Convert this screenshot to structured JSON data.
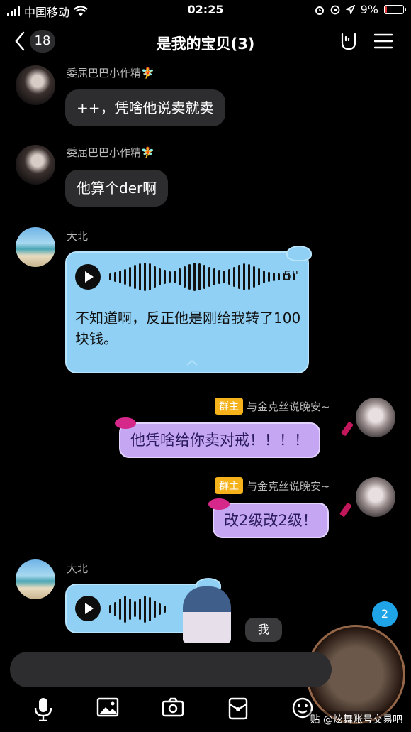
{
  "status_bar": {
    "carrier": "中国移动",
    "time": "02:25",
    "battery": "9%",
    "battery_level": 0.09,
    "icons": [
      "signal-icon",
      "wifi-icon",
      "alarm-icon",
      "lock-rotation-icon",
      "location-icon",
      "battery-icon"
    ]
  },
  "header": {
    "back_count": "18",
    "title": "是我的宝贝(3)",
    "icons": [
      "rock-hand-icon",
      "menu-icon"
    ]
  },
  "messages": [
    {
      "sender": "委屈巴巴小作精🧚",
      "text": "++，凭啥他说卖就卖"
    },
    {
      "sender": "委屈巴巴小作精🧚",
      "text": "他算个der啊"
    },
    {
      "sender": "大北",
      "voice_duration": "5''",
      "transcript": "不知道啊，反正他是刚给我转了100块钱。"
    },
    {
      "badge": "群主",
      "sender": "与金克丝说晚安~",
      "text": "他凭啥给你卖对戒！！！！"
    },
    {
      "badge": "群主",
      "sender": "与金克丝说晚安~",
      "text": "改2级改2级！"
    },
    {
      "sender": "大北",
      "me_tag": "我"
    }
  ],
  "unread_count": "2",
  "input": {
    "placeholder": ""
  },
  "toolbar": [
    "microphone-icon",
    "image-icon",
    "camera-icon",
    "red-packet-icon",
    "emoji-icon"
  ],
  "watermark_credit": "贴 @炫舞账号交易吧"
}
